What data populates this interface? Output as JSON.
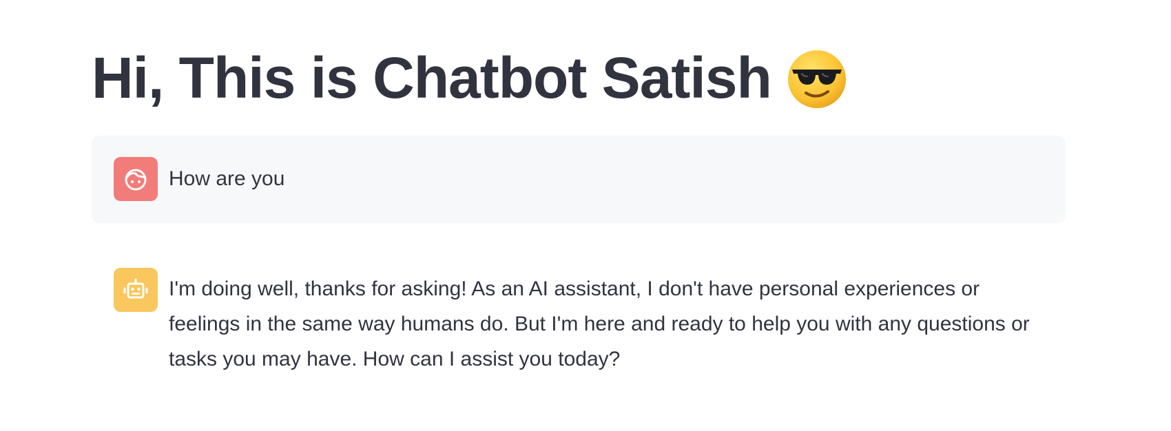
{
  "page": {
    "title": "Hi, This is Chatbot Satish",
    "title_emoji": "smiling-face-with-sunglasses"
  },
  "chat": {
    "messages": [
      {
        "role": "user",
        "avatar_icon": "user-face-icon",
        "avatar_color": "#f27c79",
        "text": "How are you"
      },
      {
        "role": "assistant",
        "avatar_icon": "robot-icon",
        "avatar_color": "#f9c75e",
        "text": "I'm doing well, thanks for asking! As an AI assistant, I don't have personal experiences or feelings in the same way humans do. But I'm here and ready to help you with any questions or tasks you may have. How can I assist you today?"
      }
    ]
  },
  "colors": {
    "text": "#31333f",
    "user_message_bg": "#f7f8fa"
  }
}
